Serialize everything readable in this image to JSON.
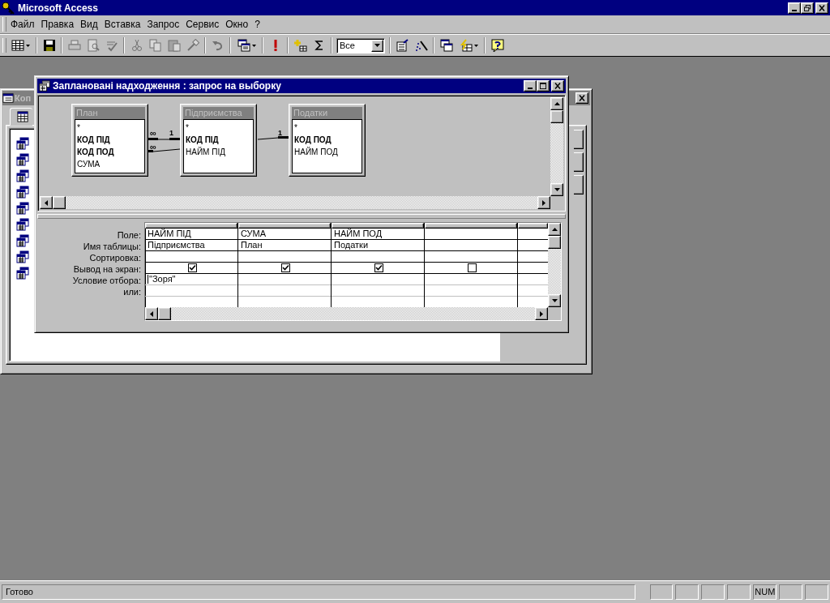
{
  "app": {
    "title": "Microsoft Access"
  },
  "menu": [
    {
      "label": "Файл"
    },
    {
      "label": "Правка"
    },
    {
      "label": "Вид"
    },
    {
      "label": "Вставка"
    },
    {
      "label": "Запрос"
    },
    {
      "label": "Сервис"
    },
    {
      "label": "Окно"
    },
    {
      "label": "?"
    }
  ],
  "toolbar": [
    {
      "kind": "view",
      "disabled": false
    },
    {
      "kind": "separator"
    },
    {
      "kind": "save",
      "disabled": false
    },
    {
      "kind": "separator"
    },
    {
      "kind": "print",
      "disabled": true
    },
    {
      "kind": "preview",
      "disabled": true
    },
    {
      "kind": "spelling",
      "disabled": true
    },
    {
      "kind": "separator"
    },
    {
      "kind": "cut",
      "disabled": true
    },
    {
      "kind": "copy",
      "disabled": true
    },
    {
      "kind": "paste",
      "disabled": true
    },
    {
      "kind": "format_painter",
      "disabled": true
    },
    {
      "kind": "separator"
    },
    {
      "kind": "undo",
      "disabled": true
    },
    {
      "kind": "separator"
    },
    {
      "kind": "query_type",
      "disabled": false
    },
    {
      "kind": "separator"
    },
    {
      "kind": "run",
      "disabled": false
    },
    {
      "kind": "separator"
    },
    {
      "kind": "show_table",
      "disabled": false
    },
    {
      "kind": "totals",
      "disabled": false
    },
    {
      "kind": "separator"
    },
    {
      "kind": "top_values",
      "value": "Все"
    },
    {
      "kind": "separator"
    },
    {
      "kind": "properties",
      "disabled": false
    },
    {
      "kind": "build",
      "disabled": false
    },
    {
      "kind": "separator"
    },
    {
      "kind": "database_window",
      "disabled": false
    },
    {
      "kind": "new_object",
      "disabled": false
    },
    {
      "kind": "separator"
    },
    {
      "kind": "help",
      "disabled": false
    }
  ],
  "back_window": {
    "title": "Коп"
  },
  "query_window": {
    "title": "Заплановані надходження : запрос на выборку",
    "tables": [
      {
        "name": "План",
        "fields": [
          {
            "name": "*",
            "key": false
          },
          {
            "name": "КОД ПІД",
            "key": true
          },
          {
            "name": "КОД ПОД",
            "key": true
          },
          {
            "name": "СУМА",
            "key": false
          }
        ]
      },
      {
        "name": "Підприємства",
        "fields": [
          {
            "name": "*",
            "key": false
          },
          {
            "name": "КОД ПІД",
            "key": true
          },
          {
            "name": "НАЙМ ПІД",
            "key": false
          }
        ]
      },
      {
        "name": "Податки",
        "fields": [
          {
            "name": "*",
            "key": false
          },
          {
            "name": "КОД ПОД",
            "key": true
          },
          {
            "name": "НАЙМ ПОД",
            "key": false
          }
        ]
      }
    ],
    "joins": [
      {
        "many": "∞",
        "one": "1"
      },
      {
        "many": "∞",
        "one": "1"
      }
    ],
    "grid": {
      "row_labels": [
        "Поле:",
        "Имя таблицы:",
        "Сортировка:",
        "Вывод на экран:",
        "Условие отбора:",
        "или:"
      ],
      "columns": [
        {
          "field": "НАЙМ ПІД",
          "table": "Підприємства",
          "show": true,
          "criteria": "\"Зоря\"",
          "editing": true
        },
        {
          "field": "СУМА",
          "table": "План",
          "show": true
        },
        {
          "field": "НАЙМ ПОД",
          "table": "Податки",
          "show": true
        },
        {
          "show": false
        }
      ]
    }
  },
  "status_bar": {
    "text": "Готово",
    "num_indicator": "NUM"
  }
}
